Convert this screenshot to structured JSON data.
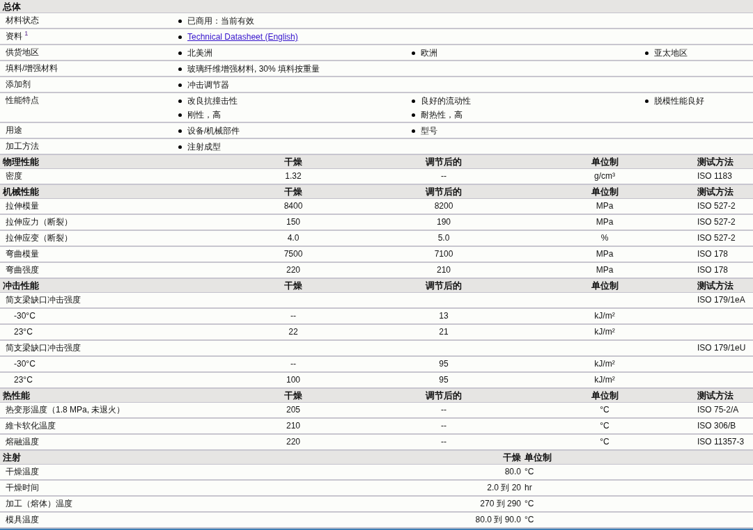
{
  "sections": [
    {
      "kind": "general",
      "title": "总体",
      "rows": [
        {
          "label": "材料状态",
          "values": [
            {
              "kind": "text",
              "text": "已商用：当前有效"
            }
          ]
        },
        {
          "label": "资料 $^{1}$",
          "values": [
            {
              "kind": "link",
              "text": "Technical Datasheet (English)"
            }
          ]
        },
        {
          "label": "供货地区",
          "values": [
            {
              "kind": "text",
              "text": "北美洲"
            },
            {
              "kind": "text",
              "text": "欧洲"
            },
            {
              "kind": "text",
              "text": "亚太地区"
            }
          ]
        },
        {
          "label": "填料/增强材料",
          "values": [
            {
              "kind": "text",
              "text": "玻璃纤维增强材料, 30% 填料按重量"
            }
          ]
        },
        {
          "label": "添加剂",
          "values": [
            {
              "kind": "text",
              "text": "冲击调节器"
            }
          ]
        },
        {
          "label": "性能特点",
          "values": [
            {
              "kind": "text",
              "text": "改良抗撞击性"
            },
            {
              "kind": "text",
              "text": "良好的流动性"
            },
            {
              "kind": "text",
              "text": "脱模性能良好"
            },
            {
              "kind": "text",
              "text": "刚性，高"
            },
            {
              "kind": "text",
              "text": "耐热性，高"
            }
          ]
        },
        {
          "label": "用途",
          "values": [
            {
              "kind": "text",
              "text": "设备/机械部件"
            },
            {
              "kind": "text",
              "text": "型号"
            }
          ]
        },
        {
          "label": "加工方法",
          "values": [
            {
              "kind": "text",
              "text": "注射成型"
            }
          ]
        }
      ]
    },
    {
      "kind": "table",
      "title": "物理性能",
      "columns": [
        "干燥",
        "调节后的",
        "单位制",
        "测试方法"
      ],
      "rows": [
        {
          "kind": "item",
          "label": "密度",
          "dry": "1.32",
          "conditioned": "--",
          "unit": "g/cm³",
          "method": "ISO 1183"
        }
      ]
    },
    {
      "kind": "table",
      "title": "机械性能",
      "columns": [
        "干燥",
        "调节后的",
        "单位制",
        "测试方法"
      ],
      "rows": [
        {
          "kind": "item",
          "label": "拉伸模量",
          "dry": "8400",
          "conditioned": "8200",
          "unit": "MPa",
          "method": "ISO 527-2"
        },
        {
          "kind": "item",
          "label": "拉伸应力（断裂）",
          "dry": "150",
          "conditioned": "190",
          "unit": "MPa",
          "method": "ISO 527-2"
        },
        {
          "kind": "item",
          "label": "拉伸应变（断裂）",
          "dry": "4.0",
          "conditioned": "5.0",
          "unit": "%",
          "method": "ISO 527-2"
        },
        {
          "kind": "item",
          "label": "弯曲模量",
          "dry": "7500",
          "conditioned": "7100",
          "unit": "MPa",
          "method": "ISO 178"
        },
        {
          "kind": "item",
          "label": "弯曲强度",
          "dry": "220",
          "conditioned": "210",
          "unit": "MPa",
          "method": "ISO 178"
        }
      ]
    },
    {
      "kind": "table",
      "title": "冲击性能",
      "columns": [
        "干燥",
        "调节后的",
        "单位制",
        "测试方法"
      ],
      "rows": [
        {
          "kind": "item",
          "label": "简支梁缺口冲击强度",
          "method": "ISO 179/1eA"
        },
        {
          "kind": "sub",
          "label": "-30°C",
          "dry": "--",
          "conditioned": "13",
          "unit": "kJ/m²"
        },
        {
          "kind": "sub",
          "label": "23°C",
          "dry": "22",
          "conditioned": "21",
          "unit": "kJ/m²"
        },
        {
          "kind": "item",
          "label": "简支梁缺口冲击强度",
          "method": "ISO 179/1eU"
        },
        {
          "kind": "sub",
          "label": "-30°C",
          "dry": "--",
          "conditioned": "95",
          "unit": "kJ/m²"
        },
        {
          "kind": "sub",
          "label": "23°C",
          "dry": "100",
          "conditioned": "95",
          "unit": "kJ/m²"
        }
      ]
    },
    {
      "kind": "table",
      "title": "热性能",
      "columns": [
        "干燥",
        "调节后的",
        "单位制",
        "测试方法"
      ],
      "rows": [
        {
          "kind": "item",
          "label": "热变形温度（1.8 MPa, 未退火）",
          "dry": "205",
          "conditioned": "--",
          "unit": "°C",
          "method": "ISO 75-2/A"
        },
        {
          "kind": "item",
          "label": "維卡软化温度",
          "dry": "210",
          "conditioned": "--",
          "unit": "°C",
          "method": "ISO 306/B"
        },
        {
          "kind": "item",
          "label": "熔融温度",
          "dry": "220",
          "conditioned": "--",
          "unit": "°C",
          "method": "ISO 11357-3"
        }
      ]
    },
    {
      "kind": "injection",
      "title": "注射",
      "columns": [
        "干燥",
        "单位制"
      ],
      "rows": [
        {
          "label": "干燥温度",
          "value": "80.0",
          "unit": "°C"
        },
        {
          "label": "干燥时间",
          "value": "2.0 到 20",
          "unit": "hr"
        },
        {
          "label": "加工（熔体）温度",
          "value": "270 到 290",
          "unit": "°C"
        },
        {
          "label": "模具温度",
          "value": "80.0 到 90.0",
          "unit": "°C"
        }
      ]
    }
  ]
}
